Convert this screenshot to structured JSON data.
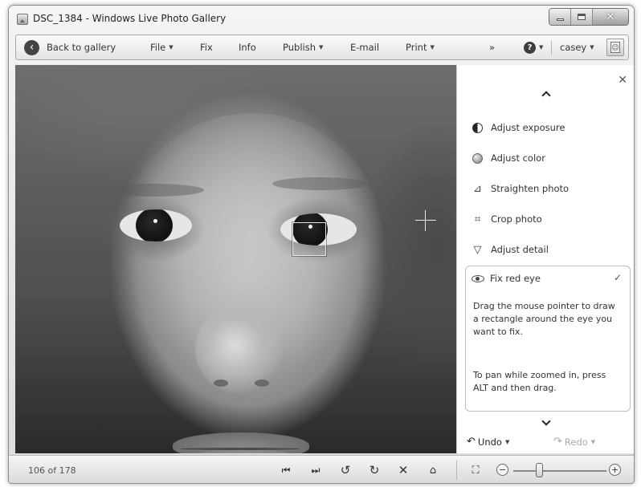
{
  "window": {
    "title": "DSC_1384 - Windows Live Photo Gallery"
  },
  "toolbar": {
    "back_label": "Back to gallery",
    "file_label": "File",
    "fix_label": "Fix",
    "info_label": "Info",
    "publish_label": "Publish",
    "email_label": "E-mail",
    "print_label": "Print",
    "overflow_label": "»",
    "help_label": "?",
    "user_label": "casey"
  },
  "panel": {
    "items": [
      {
        "label": "Adjust exposure",
        "icon": "half-circle-icon"
      },
      {
        "label": "Adjust color",
        "icon": "color-ball-icon"
      },
      {
        "label": "Straighten photo",
        "icon": "straighten-icon"
      },
      {
        "label": "Crop photo",
        "icon": "crop-icon"
      },
      {
        "label": "Adjust detail",
        "icon": "triangle-detail-icon"
      }
    ],
    "fix_red_eye": {
      "label": "Fix red eye",
      "instruction": "Drag the mouse pointer to draw a rectangle around the eye you want to fix.",
      "pan_hint": "To pan while zoomed in, press ALT and then drag."
    },
    "undo_label": "Undo",
    "redo_label": "Redo"
  },
  "status": {
    "counter": "106 of 178",
    "zoom_level": 0.28
  }
}
